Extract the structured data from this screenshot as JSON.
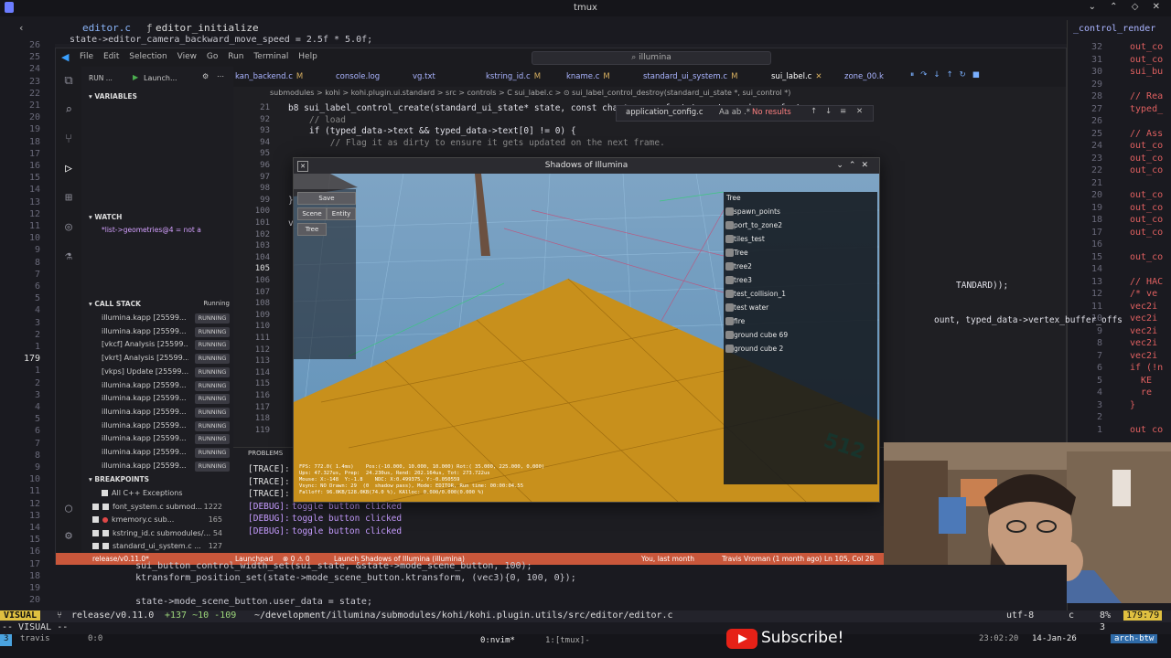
{
  "tmux": {
    "title": "tmux",
    "window_controls": "⌄ ⌃ ◇ ✕"
  },
  "nvim_top": {
    "file": "editor.c",
    "function": "editor_initialize",
    "line_code": "state->editor_camera_backward_move_speed = 2.5f * 5.0f;",
    "line_nums": [
      "26",
      "25",
      "24",
      "23",
      "22",
      "21",
      "20",
      "19",
      "18",
      "17",
      "16",
      "15",
      "14",
      "13",
      "12",
      "11",
      "10",
      "9",
      "8",
      "7",
      "6",
      "5",
      "4",
      "3",
      "2",
      "1",
      "179",
      "1",
      "2",
      "3",
      "4",
      "5",
      "6",
      "7",
      "8",
      "9",
      "10",
      "11",
      "12",
      "13",
      "14",
      "15",
      "16",
      "17",
      "18",
      "19",
      "20"
    ]
  },
  "right_pane": {
    "header": "_control_render",
    "line_nums": [
      "32",
      "31",
      "30",
      "29",
      "28",
      "27",
      "26",
      "25",
      "24",
      "23",
      "22",
      "21",
      "20",
      "19",
      "18",
      "17",
      "16",
      "15",
      "14",
      "13",
      "12",
      "11",
      "10",
      "9",
      "8",
      "7",
      "6",
      "5",
      "4",
      "3",
      "2",
      "1"
    ],
    "code": [
      "out_co",
      "out_co",
      "sui_bu",
      "",
      "// Rea",
      "typed_",
      "",
      "// Ass",
      "out_co",
      "out_co",
      "out_co",
      "",
      "out_co",
      "out_co",
      "out_co",
      "out_co",
      "",
      "out_co",
      "",
      "// HAC",
      "/* ve",
      "vec2i",
      "vec2i",
      "vec2i",
      "vec2i",
      "vec2i",
      "if (!n",
      "  KE",
      "  re",
      "}",
      "",
      "out co"
    ]
  },
  "vscode": {
    "menu": [
      "File",
      "Edit",
      "Selection",
      "View",
      "Go",
      "Run",
      "Terminal",
      "Help"
    ],
    "search": "illumina",
    "run_label": "RUN ...",
    "launch_label": "Launch...",
    "variables_label": "VARIABLES",
    "watch_label": "WATCH",
    "watch_item": "*list->geometries@4 = not a",
    "call_stack_label": "CALL STACK",
    "call_stack_status": "Running",
    "call_stack": [
      {
        "name": "illumina.kapp [25599...",
        "state": "RUNNING"
      },
      {
        "name": "illumina.kapp [25599...",
        "state": "RUNNING"
      },
      {
        "name": "[vkcf] Analysis [25599...",
        "state": "RUNNING"
      },
      {
        "name": "[vkrt] Analysis [25599...",
        "state": "RUNNING"
      },
      {
        "name": "[vkps] Update [25599...",
        "state": "RUNNING"
      },
      {
        "name": "illumina.kapp [25599...",
        "state": "RUNNING"
      },
      {
        "name": "illumina.kapp [25599...",
        "state": "RUNNING"
      },
      {
        "name": "illumina.kapp [25599...",
        "state": "RUNNING"
      },
      {
        "name": "illumina.kapp [25599...",
        "state": "RUNNING"
      },
      {
        "name": "illumina.kapp [25599...",
        "state": "RUNNING"
      },
      {
        "name": "illumina.kapp [25599...",
        "state": "RUNNING"
      },
      {
        "name": "illumina.kapp [25599...",
        "state": "RUNNING"
      }
    ],
    "breakpoints_label": "BREAKPOINTS",
    "breakpoints": [
      {
        "name": "All C++ Exceptions",
        "count": "",
        "kind": "check"
      },
      {
        "name": "font_system.c  submod...",
        "count": "1222",
        "kind": "check"
      },
      {
        "name": "kmemory.c  sub...",
        "count": "165",
        "kind": "dot"
      },
      {
        "name": "kstring_id.c  submodules/...",
        "count": "54",
        "kind": "check"
      },
      {
        "name": "standard_ui_system.c ...",
        "count": "127",
        "kind": "check"
      }
    ],
    "tabs": [
      {
        "name": "kan_backend.c",
        "mark": "M"
      },
      {
        "name": "console.log",
        "mark": ""
      },
      {
        "name": "vg.txt",
        "mark": ""
      },
      {
        "name": "kstring_id.c",
        "mark": "M"
      },
      {
        "name": "kname.c",
        "mark": "M"
      },
      {
        "name": "standard_ui_system.c",
        "mark": "M"
      },
      {
        "name": "sui_label.c",
        "mark": "✕"
      },
      {
        "name": "zone_00.k",
        "mark": ""
      }
    ],
    "breadcrumb": "submodules > kohi > kohi.plugin.ui.standard > src > controls > C sui_label.c > ⊙ sui_label_control_destroy(standard_ui_state *, sui_control *)",
    "find_text": "application_config.c",
    "find_result": "No results",
    "editor_lines": [
      {
        "n": "21",
        "code": "b8 sui_label_control_create(standard_ui_state* state, const char* name, font_type type, kname font_n"
      },
      {
        "n": "92",
        "code": "    // load"
      },
      {
        "n": "93",
        "code": "    if (typed_data->text && typed_data->text[0] != 0) {"
      },
      {
        "n": "94",
        "code": "        // Flag it as dirty to ensure it gets updated on the next frame."
      },
      {
        "n": "95",
        "code": ""
      },
      {
        "n": "96",
        "code": ""
      },
      {
        "n": "97",
        "code": ""
      },
      {
        "n": "98",
        "code": ""
      },
      {
        "n": "99",
        "code": "}"
      },
      {
        "n": "100",
        "code": ""
      },
      {
        "n": "101",
        "code": "voi"
      },
      {
        "n": "102",
        "code": ""
      },
      {
        "n": "103",
        "code": ""
      },
      {
        "n": "104",
        "code": ""
      },
      {
        "n": "105",
        "code": ""
      },
      {
        "n": "106",
        "code": ""
      },
      {
        "n": "107",
        "code": ""
      },
      {
        "n": "108",
        "code": ""
      },
      {
        "n": "109",
        "code": ""
      },
      {
        "n": "110",
        "code": ""
      },
      {
        "n": "111",
        "code": ""
      },
      {
        "n": "112",
        "code": ""
      },
      {
        "n": "113",
        "code": ""
      },
      {
        "n": "114",
        "code": ""
      },
      {
        "n": "115",
        "code": ""
      },
      {
        "n": "116",
        "code": ""
      },
      {
        "n": "117",
        "code": ""
      },
      {
        "n": "118",
        "code": ""
      },
      {
        "n": "119",
        "code": ""
      }
    ],
    "editor_tail_1": "TANDARD));",
    "editor_tail_2": "ount, typed_data->vertex_buffer_offs",
    "problems_label": "PROBLEMS",
    "terminal": [
      {
        "tag": "[TRACE]:",
        "text": "",
        "color": "#e0e0e0"
      },
      {
        "tag": "[TRACE]:",
        "text": "",
        "color": "#e0e0e0"
      },
      {
        "tag": "[TRACE]:",
        "text": "",
        "color": "#e0e0e0"
      },
      {
        "tag": "[DEBUG]:",
        "text": "toggle button clicked",
        "color": "#c69cff"
      },
      {
        "tag": "[DEBUG]:",
        "text": "toggle button clicked",
        "color": "#c69cff"
      },
      {
        "tag": "[DEBUG]:",
        "text": "toggle button clicked",
        "color": "#c69cff"
      }
    ],
    "status": {
      "branch": "release/v0.11.0*",
      "launchpad": "Launchpad",
      "errors": "⊗ 0 ⚠ 0",
      "debug": "Launch Shadows of Illumina (illumina)",
      "blame": "You, last month",
      "author": "Travis Vroman (1 month ago)",
      "position": "Ln 105, Col 28"
    }
  },
  "game": {
    "title": "Shadows of Illumina",
    "buttons": {
      "save": "Save",
      "scene": "Scene",
      "entity": "Entity",
      "tree": "Tree"
    },
    "tree_title": "Tree",
    "tree_items": [
      "spawn_points",
      "port_to_zone2",
      "tiles_test",
      "Tree",
      "tree2",
      "tree3",
      "test_collision_1",
      "test water",
      "fire",
      "ground cube 69",
      "ground cube 2"
    ],
    "debug_text": "FPS: 772.0( 1.4ms)    Pos:(-10.000, 10.000, 10.000) Rot:( 35.000, 225.000, 0.000)\nUps: 47.327us, Prep:  24.230us, Rend: 202.164us, Tot: 273.722us\nMouse: X:-148  Y:-1.8    NDC: X:0.499375, Y:-0.050559\nVsync: NO Drawn: 29  (0  shadow pass), Mode: EDITOR, Run time: 00:00:04.55\nFalloff: 96.0KB/128.0KB(74.0 %), KAlloc: 0.000/0.000(0.000 %)",
    "floor_label": "512"
  },
  "nvim_bottom": {
    "lines": [
      {
        "n": "17",
        "code": "    sui_button_control_width_set(sui_state, &state->mode_scene_button, 100);"
      },
      {
        "n": "18",
        "code": "    ktransform_position_set(state->mode_scene_button.ktransform, (vec3){0, 100, 0});"
      },
      {
        "n": "19",
        "code": ""
      },
      {
        "n": "20",
        "code": "    state->mode_scene_button.user_data = state;"
      }
    ]
  },
  "statusline": {
    "mode": "VISUAL",
    "branch": "release/v0.11.0",
    "diff": "+137 ~10 -109",
    "path": "~/development/illumina/submodules/kohi/kohi.plugin.utils/src/editor/editor.c",
    "encoding": "utf-8",
    "os": "c",
    "percent": "8%",
    "position": "179:79"
  },
  "modeline": {
    "text": "-- VISUAL --",
    "count": "3"
  },
  "tmux_bottom": {
    "session": "3",
    "user": "travis",
    "pane": "0:0",
    "win0": "0:nvim*",
    "win1": "1:[tmux]-",
    "time": "23:02:20",
    "date": "14-Jan-26",
    "host": "arch-btw"
  },
  "subscribe": "Subscribe!"
}
